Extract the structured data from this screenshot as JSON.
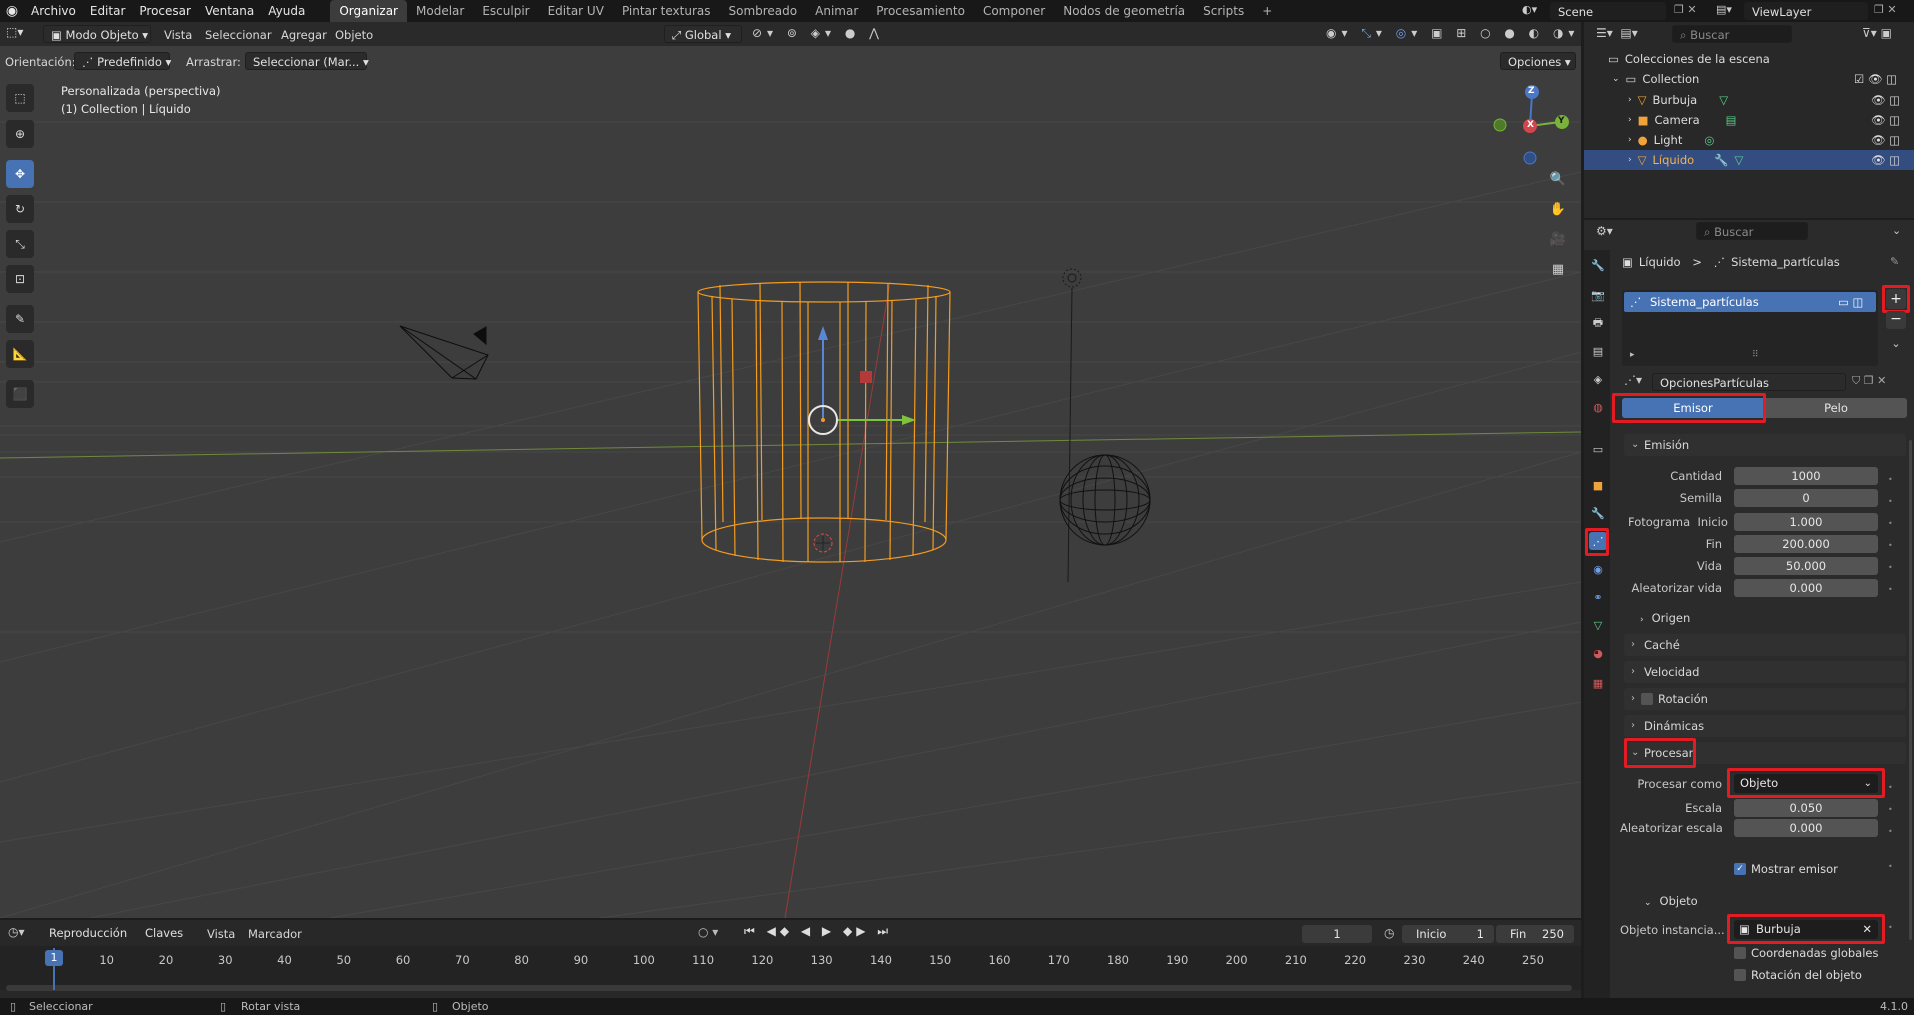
{
  "menubar": {
    "items": [
      "Archivo",
      "Editar",
      "Procesar",
      "Ventana",
      "Ayuda"
    ],
    "workspaces": [
      "Organizar",
      "Modelar",
      "Esculpir",
      "Editar UV",
      "Pintar texturas",
      "Sombreado",
      "Animar",
      "Procesamiento",
      "Componer",
      "Nodos de geometría",
      "Scripts"
    ],
    "active_workspace": "Organizar",
    "add_tab": "+",
    "scene": "Scene",
    "view_layer": "ViewLayer"
  },
  "viewport_header": {
    "mode": "Modo Objeto",
    "menus": [
      "Vista",
      "Seleccionar",
      "Agregar",
      "Objeto"
    ],
    "transform": "Global",
    "options": "Opciones"
  },
  "tool_settings": {
    "orientation_label": "Orientación:",
    "orientation_value": "Predefinido",
    "drag_label": "Arrastrar:",
    "drag_value": "Seleccionar (Mar..."
  },
  "viewport": {
    "view_name": "Personalizada (perspectiva)",
    "collection_info": "(1) Collection | Líquido",
    "gizmo_axes": [
      "Z",
      "Y",
      "X"
    ]
  },
  "outliner": {
    "search_placeholder": "Buscar",
    "root": "Colecciones de la escena",
    "collection": "Collection",
    "items": [
      {
        "name": "Burbuja",
        "selected": false
      },
      {
        "name": "Camera",
        "selected": false
      },
      {
        "name": "Light",
        "selected": false
      },
      {
        "name": "Líquido",
        "selected": true
      }
    ]
  },
  "properties": {
    "search_placeholder": "Buscar",
    "breadcrumb_object": "Líquido",
    "breadcrumb_sep": ">",
    "breadcrumb_system": "Sistema_partículas",
    "system_list": [
      "Sistema_partículas"
    ],
    "settings_name": "OpcionesPartículas",
    "type_buttons": {
      "emitter": "Emisor",
      "hair": "Pelo"
    },
    "emission": {
      "header": "Emisión",
      "count_label": "Cantidad",
      "count": "1000",
      "seed_label": "Semilla",
      "seed": "0",
      "frame_label": "Fotograma",
      "start_label": "Inicio",
      "start": "1.000",
      "end_label": "Fin",
      "end": "200.000",
      "life_label": "Vida",
      "life": "50.000",
      "random_life_label": "Aleatorizar vida",
      "random_life": "0.000",
      "source": "Origen"
    },
    "panels": [
      "Caché",
      "Velocidad",
      "Rotación",
      "Dinámicas"
    ],
    "render": {
      "header": "Procesar",
      "render_as_label": "Procesar como",
      "render_as": "Objeto",
      "scale_label": "Escala",
      "scale": "0.050",
      "random_scale_label": "Aleatorizar escala",
      "random_scale": "0.000",
      "show_emitter": "Mostrar emisor"
    },
    "object": {
      "header": "Objeto",
      "instance_label": "Objeto instancia...",
      "instance_value": "Burbuja",
      "global_coords": "Coordenadas globales",
      "object_rotation": "Rotación del objeto"
    }
  },
  "timeline": {
    "menus": [
      "Reproducción",
      "Claves",
      "Vista",
      "Marcador"
    ],
    "current_frame": "1",
    "start_label": "Inicio",
    "start": "1",
    "end_label": "Fin",
    "end": "250",
    "ticks": [
      "1",
      "10",
      "20",
      "30",
      "40",
      "50",
      "60",
      "70",
      "80",
      "90",
      "100",
      "110",
      "120",
      "130",
      "140",
      "150",
      "160",
      "170",
      "180",
      "190",
      "200",
      "210",
      "220",
      "230",
      "240",
      "250"
    ]
  },
  "statusbar": {
    "select": "Seleccionar",
    "rotate": "Rotar vista",
    "object": "Objeto",
    "version": "4.1.0"
  },
  "colors": {
    "accent": "#4772b3",
    "highlight": "#e31b23",
    "selection": "#f39c1f"
  }
}
